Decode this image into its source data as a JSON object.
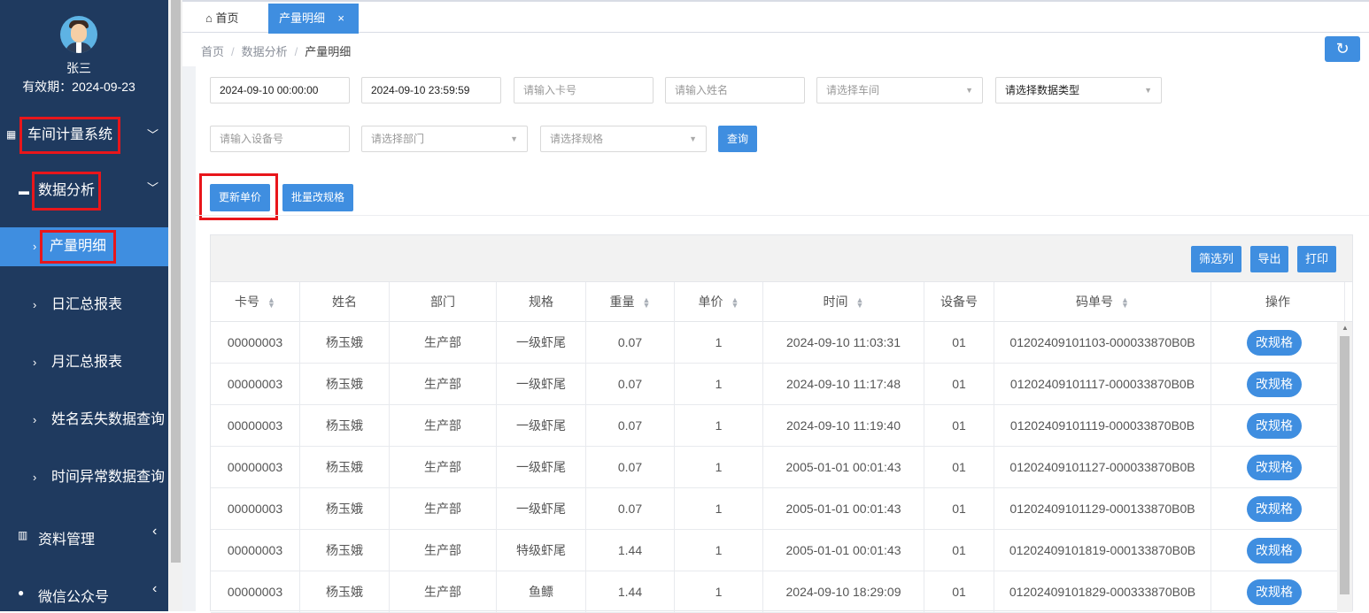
{
  "user": {
    "name": "张三",
    "expiry": "有效期：2024-09-23"
  },
  "sidebar": {
    "menus": [
      {
        "label": "车间计量系统",
        "icon": "grid-icon",
        "chevron": "﹀"
      },
      {
        "label": "数据分析",
        "icon": "monitor-icon",
        "chevron": "﹀"
      },
      {
        "label": "资料管理",
        "icon": "book-icon",
        "chevron": "‹"
      },
      {
        "label": "微信公众号",
        "icon": "wechat-icon",
        "chevron": "‹"
      }
    ],
    "subitems": [
      {
        "label": "产量明细",
        "active": true
      },
      {
        "label": "日汇总报表"
      },
      {
        "label": "月汇总报表"
      },
      {
        "label": "姓名丢失数据查询"
      },
      {
        "label": "时间异常数据查询"
      }
    ]
  },
  "tabs": {
    "home": "首页",
    "current": "产量明细",
    "close": "×"
  },
  "breadcrumb": {
    "home": "首页",
    "section": "数据分析",
    "current": "产量明细",
    "sep": "/"
  },
  "filters": {
    "start_time": "2024-09-10 00:00:00",
    "end_time": "2024-09-10 23:59:59",
    "card_placeholder": "请输入卡号",
    "name_placeholder": "请输入姓名",
    "workshop_placeholder": "请选择车间",
    "datatype_placeholder": "请选择数据类型",
    "device_placeholder": "请输入设备号",
    "dept_placeholder": "请选择部门",
    "spec_placeholder": "请选择规格",
    "query_label": "查询"
  },
  "actions": {
    "update_price": "更新单价",
    "batch_spec": "批量改规格"
  },
  "table_tools": {
    "filter_cols": "筛选列",
    "export": "导出",
    "print": "打印"
  },
  "columns": [
    "卡号",
    "姓名",
    "部门",
    "规格",
    "重量",
    "单价",
    "时间",
    "设备号",
    "码单号",
    "操作"
  ],
  "rows": [
    {
      "card": "00000003",
      "name": "杨玉娥",
      "dept": "生产部",
      "spec": "一级虾尾",
      "weight": "0.07",
      "price": "1",
      "time": "2024-09-10 11:03:31",
      "device": "01",
      "code": "01202409101103-000033870B0B",
      "op": "改规格"
    },
    {
      "card": "00000003",
      "name": "杨玉娥",
      "dept": "生产部",
      "spec": "一级虾尾",
      "weight": "0.07",
      "price": "1",
      "time": "2024-09-10 11:17:48",
      "device": "01",
      "code": "01202409101117-000033870B0B",
      "op": "改规格"
    },
    {
      "card": "00000003",
      "name": "杨玉娥",
      "dept": "生产部",
      "spec": "一级虾尾",
      "weight": "0.07",
      "price": "1",
      "time": "2024-09-10 11:19:40",
      "device": "01",
      "code": "01202409101119-000033870B0B",
      "op": "改规格"
    },
    {
      "card": "00000003",
      "name": "杨玉娥",
      "dept": "生产部",
      "spec": "一级虾尾",
      "weight": "0.07",
      "price": "1",
      "time": "2005-01-01 00:01:43",
      "device": "01",
      "code": "01202409101127-000033870B0B",
      "op": "改规格"
    },
    {
      "card": "00000003",
      "name": "杨玉娥",
      "dept": "生产部",
      "spec": "一级虾尾",
      "weight": "0.07",
      "price": "1",
      "time": "2005-01-01 00:01:43",
      "device": "01",
      "code": "01202409101129-000133870B0B",
      "op": "改规格"
    },
    {
      "card": "00000003",
      "name": "杨玉娥",
      "dept": "生产部",
      "spec": "特级虾尾",
      "weight": "1.44",
      "price": "1",
      "time": "2005-01-01 00:01:43",
      "device": "01",
      "code": "01202409101819-000133870B0B",
      "op": "改规格"
    },
    {
      "card": "00000003",
      "name": "杨玉娥",
      "dept": "生产部",
      "spec": "鱼鳔",
      "weight": "1.44",
      "price": "1",
      "time": "2024-09-10 18:29:09",
      "device": "01",
      "code": "01202409101829-000333870B0B",
      "op": "改规格"
    }
  ],
  "colors": {
    "sidebar_bg": "#1f3a5f",
    "accent": "#3f8ee0",
    "highlight": "#e8161b"
  }
}
